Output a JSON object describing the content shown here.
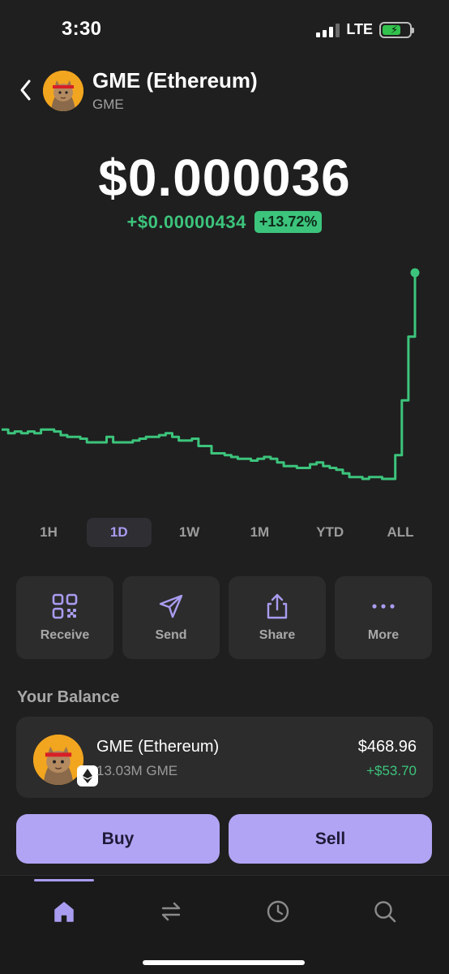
{
  "status_bar": {
    "time": "3:30",
    "network": "LTE"
  },
  "header": {
    "title": "GME (Ethereum)",
    "subtitle": "GME"
  },
  "price": {
    "value": "$0.000036",
    "change_abs": "+$0.00000434",
    "change_pct": "+13.72%"
  },
  "colors": {
    "accent": "#a89cf0",
    "positive": "#3cc47c",
    "button": "#b1a4f4"
  },
  "chart_data": {
    "type": "line",
    "y": [
      3.34e-05,
      3.32e-05,
      3.33e-05,
      3.32e-05,
      3.33e-05,
      3.32e-05,
      3.34e-05,
      3.34e-05,
      3.33e-05,
      3.31e-05,
      3.3e-05,
      3.3e-05,
      3.29e-05,
      3.27e-05,
      3.27e-05,
      3.27e-05,
      3.3e-05,
      3.27e-05,
      3.27e-05,
      3.27e-05,
      3.28e-05,
      3.29e-05,
      3.3e-05,
      3.3e-05,
      3.31e-05,
      3.32e-05,
      3.3e-05,
      3.28e-05,
      3.28e-05,
      3.29e-05,
      3.25e-05,
      3.25e-05,
      3.21e-05,
      3.21e-05,
      3.2e-05,
      3.19e-05,
      3.18e-05,
      3.18e-05,
      3.17e-05,
      3.18e-05,
      3.19e-05,
      3.18e-05,
      3.16e-05,
      3.14e-05,
      3.14e-05,
      3.13e-05,
      3.13e-05,
      3.15e-05,
      3.16e-05,
      3.14e-05,
      3.13e-05,
      3.12e-05,
      3.1e-05,
      3.08e-05,
      3.08e-05,
      3.07e-05,
      3.08e-05,
      3.08e-05,
      3.07e-05,
      3.07e-05,
      3.2e-05,
      3.5e-05,
      3.85e-05,
      4.2e-05
    ],
    "line_color": "#3cc47c"
  },
  "ranges": {
    "selected": "1D",
    "items": [
      {
        "label": "1H"
      },
      {
        "label": "1D"
      },
      {
        "label": "1W"
      },
      {
        "label": "1M"
      },
      {
        "label": "YTD"
      },
      {
        "label": "ALL"
      }
    ]
  },
  "actions": [
    {
      "label": "Receive",
      "icon": "qr-code-icon"
    },
    {
      "label": "Send",
      "icon": "send-icon"
    },
    {
      "label": "Share",
      "icon": "share-icon"
    },
    {
      "label": "More",
      "icon": "more-icon"
    }
  ],
  "balance": {
    "heading": "Your Balance",
    "name": "GME (Ethereum)",
    "amount": "13.03M GME",
    "value": "$468.96",
    "change": "+$53.70"
  },
  "buttons": {
    "buy": "Buy",
    "sell": "Sell"
  },
  "tabbar": [
    {
      "icon": "home-icon",
      "active": true
    },
    {
      "icon": "swap-icon",
      "active": false
    },
    {
      "icon": "history-icon",
      "active": false
    },
    {
      "icon": "search-icon",
      "active": false
    }
  ]
}
